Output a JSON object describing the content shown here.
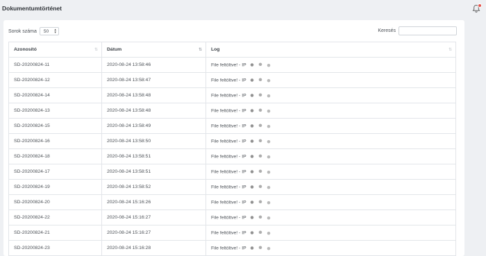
{
  "page": {
    "title": "Dokumentumtörténet"
  },
  "notifications": {
    "badge_color": "#e4544c"
  },
  "controls": {
    "rows_label": "Sorok száma",
    "rows_value": "50",
    "search_label": "Keresés",
    "search_value": ""
  },
  "table": {
    "columns": [
      {
        "label": "Azonosító",
        "sort": "none"
      },
      {
        "label": "Dátum",
        "sort": "ascending"
      },
      {
        "label": "Log",
        "sort": "none"
      }
    ],
    "rows": [
      {
        "id": "SD-20200824-11",
        "date": "2020-08-24 13:58:46",
        "log": "File feltöltve! - IP"
      },
      {
        "id": "SD-20200824-12",
        "date": "2020-08-24 13:58:47",
        "log": "File feltöltve! - IP"
      },
      {
        "id": "SD-20200824-14",
        "date": "2020-08-24 13:58:48",
        "log": "File feltöltve! - IP"
      },
      {
        "id": "SD-20200824-13",
        "date": "2020-08-24 13:58:48",
        "log": "File feltöltve! - IP"
      },
      {
        "id": "SD-20200824-15",
        "date": "2020-08-24 13:58:49",
        "log": "File feltöltve! - IP"
      },
      {
        "id": "SD-20200824-16",
        "date": "2020-08-24 13:58:50",
        "log": "File feltöltve! - IP"
      },
      {
        "id": "SD-20200824-18",
        "date": "2020-08-24 13:58:51",
        "log": "File feltöltve! - IP"
      },
      {
        "id": "SD-20200824-17",
        "date": "2020-08-24 13:58:51",
        "log": "File feltöltve! - IP"
      },
      {
        "id": "SD-20200824-19",
        "date": "2020-08-24 13:58:52",
        "log": "File feltöltve! - IP"
      },
      {
        "id": "SD-20200824-20",
        "date": "2020-08-24 15:16:26",
        "log": "File feltöltve! - IP"
      },
      {
        "id": "SD-20200824-22",
        "date": "2020-08-24 15:16:27",
        "log": "File feltöltve! - IP"
      },
      {
        "id": "SD-20200824-21",
        "date": "2020-08-24 15:16:27",
        "log": "File feltöltve! - IP"
      },
      {
        "id": "SD-20200824-23",
        "date": "2020-08-24 15:16:28",
        "log": "File feltöltve! - IP"
      }
    ]
  }
}
